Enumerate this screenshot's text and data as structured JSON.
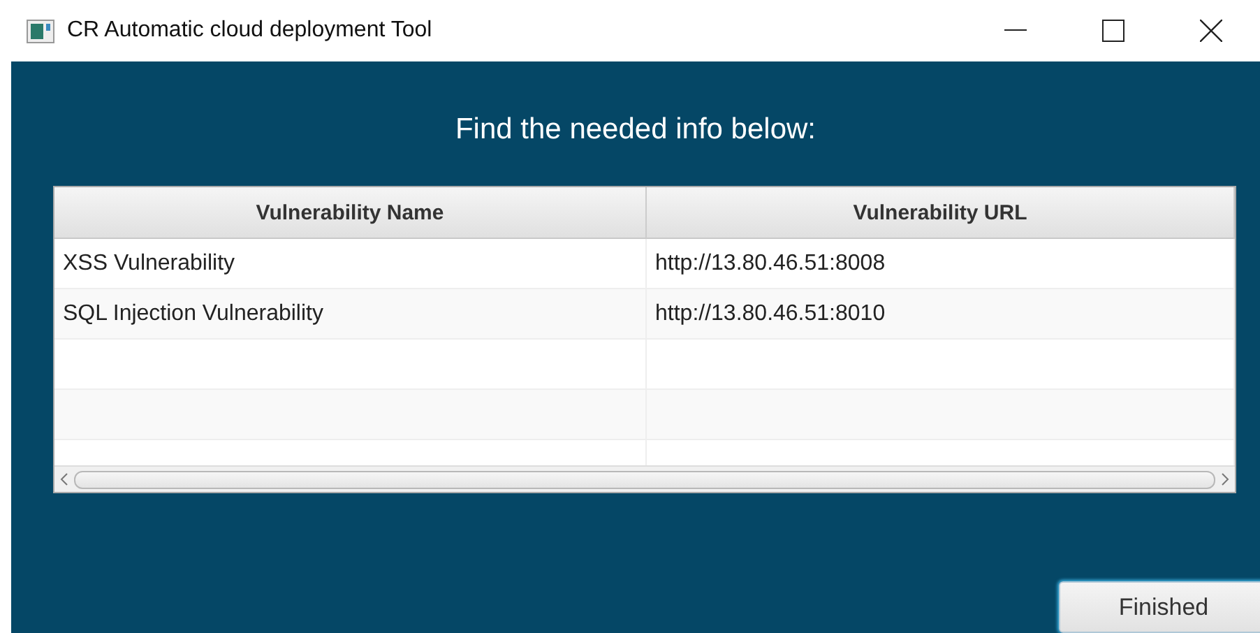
{
  "window": {
    "title": "CR Automatic cloud deployment Tool"
  },
  "heading": "Find the needed info below:",
  "table": {
    "columns": [
      "Vulnerability Name",
      "Vulnerability URL"
    ],
    "rows": [
      [
        "XSS Vulnerability",
        "http://13.80.46.51:8008"
      ],
      [
        "SQL Injection Vulnerability",
        "http://13.80.46.51:8010"
      ]
    ]
  },
  "buttons": [
    "Finished"
  ]
}
